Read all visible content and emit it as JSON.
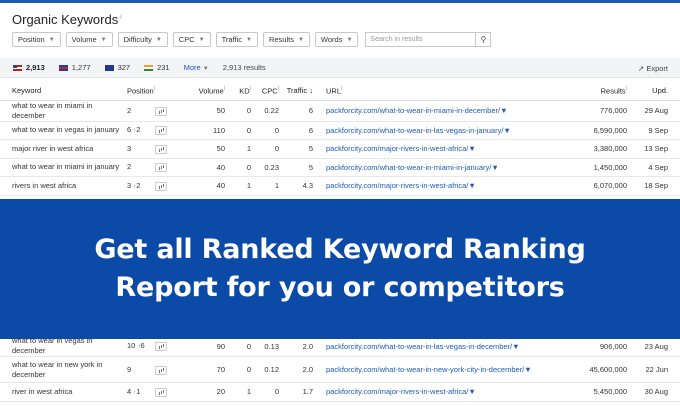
{
  "title": "Organic Keywords",
  "filters": [
    "Position",
    "Volume",
    "Difficulty",
    "CPC",
    "Traffic",
    "Results",
    "Words"
  ],
  "search_placeholder": "Search in results",
  "search_icon": "magnifier-icon",
  "countries": [
    {
      "flag": "us",
      "count": "2,913"
    },
    {
      "flag": "gb",
      "count": "1,277"
    },
    {
      "flag": "au",
      "count": "327"
    },
    {
      "flag": "in",
      "count": "231"
    }
  ],
  "more_label": "More",
  "results_count": "2,913 results",
  "export_label": "Export",
  "columns": [
    "Keyword",
    "Position",
    "Volume",
    "KD",
    "CPC",
    "Traffic",
    "URL",
    "Results",
    "Upd."
  ],
  "rows": [
    {
      "keyword": "what to wear in miami in december",
      "position": "2",
      "pos_change": "",
      "volume": "50",
      "kd": "0",
      "cpc": "0.22",
      "traffic": "6",
      "url": "packforcity.com/what-to-wear-in-miami-in-december/",
      "results": "776,000",
      "updated": "29 Aug"
    },
    {
      "keyword": "what to wear in vegas in january",
      "position": "6",
      "pos_change": "2",
      "volume": "110",
      "kd": "0",
      "cpc": "0",
      "traffic": "6",
      "url": "packforcity.com/what-to-wear-in-las-vegas-in-january/",
      "results": "6,590,000",
      "updated": "9 Sep"
    },
    {
      "keyword": "major river in west africa",
      "position": "3",
      "pos_change": "",
      "volume": "50",
      "kd": "1",
      "cpc": "0",
      "traffic": "5",
      "url": "packforcity.com/major-rivers-in-west-africa/",
      "results": "3,380,000",
      "updated": "13 Sep"
    },
    {
      "keyword": "what to wear in miami in january",
      "position": "2",
      "pos_change": "",
      "volume": "40",
      "kd": "0",
      "cpc": "0.23",
      "traffic": "5",
      "url": "packforcity.com/what-to-wear-in-miami-in-january/",
      "results": "1,450,000",
      "updated": "4 Sep"
    },
    {
      "keyword": "rivers in west africa",
      "position": "3",
      "pos_change": "2",
      "volume": "40",
      "kd": "1",
      "cpc": "1",
      "traffic": "4.3",
      "url": "packforcity.com/major-rivers-in-west-africa/",
      "results": "6,070,000",
      "updated": "18 Sep"
    }
  ],
  "banner_line1": "Get all Ranked Keyword Ranking",
  "banner_line2": "Report for you or competitors",
  "bottom_rows": [
    {
      "keyword": "what to wear in vegas in december",
      "position": "10",
      "pos_change": "6",
      "volume": "90",
      "kd": "0",
      "cpc": "0.13",
      "traffic": "2.0",
      "url": "packforcity.com/what-to-wear-in-las-vegas-in-december/",
      "results": "906,000",
      "updated": "23 Aug"
    },
    {
      "keyword": "what to wear in new york in december",
      "position": "9",
      "pos_change": "",
      "volume": "70",
      "kd": "0",
      "cpc": "0.12",
      "traffic": "2.0",
      "url": "packforcity.com/what-to-wear-in-new-york-city-in-december/",
      "results": "45,600,000",
      "updated": "22 Jun"
    },
    {
      "keyword": "river in west africa",
      "position": "4",
      "pos_change": "1",
      "volume": "20",
      "kd": "1",
      "cpc": "0",
      "traffic": "1.7",
      "url": "packforcity.com/major-rivers-in-west-africa/",
      "results": "5,450,000",
      "updated": "30 Aug"
    }
  ]
}
